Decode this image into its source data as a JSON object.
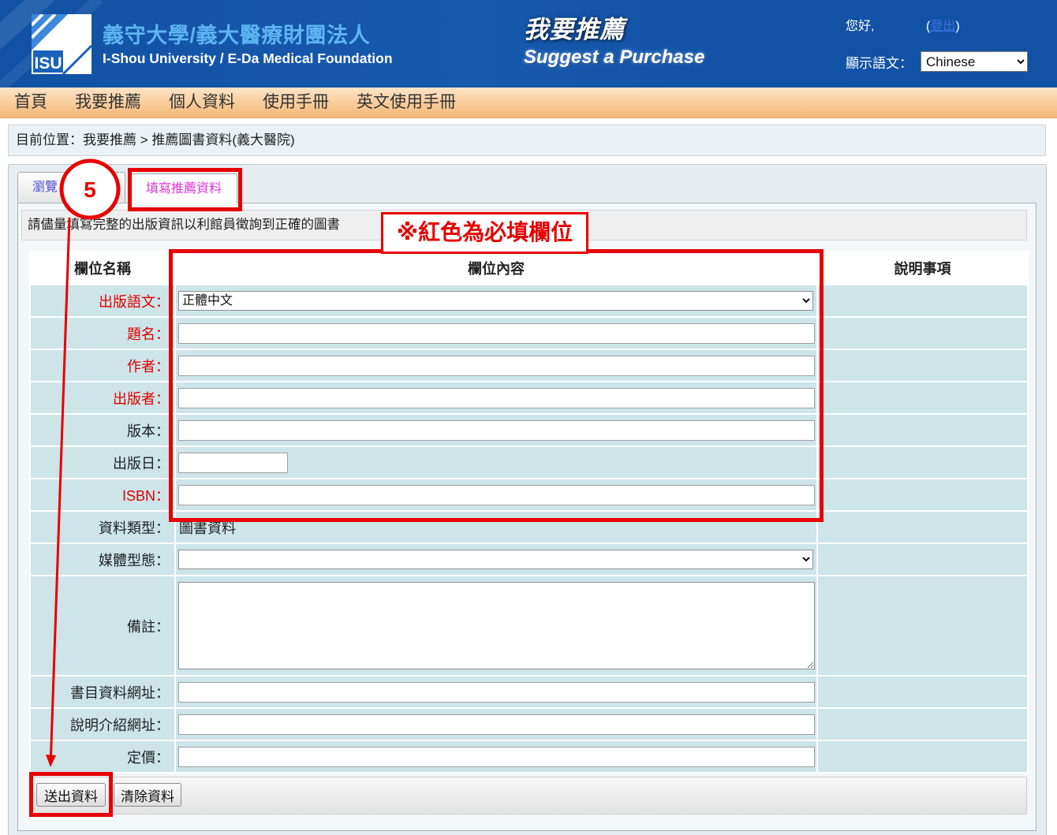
{
  "header": {
    "logo_text": "ISU",
    "org_name_zh": "義守大學/義大醫療財團法人",
    "org_name_en": "I-Shou University / E-Da Medical Foundation",
    "title_zh": "我要推薦",
    "title_en": "Suggest a Purchase",
    "greeting": "您好,",
    "logout": {
      "open": "(",
      "label": "登出",
      "close": ")"
    },
    "language_label": "顯示語文：",
    "language_selected": "Chinese"
  },
  "nav": {
    "items": [
      {
        "label": "首頁"
      },
      {
        "label": "我要推薦"
      },
      {
        "label": "個人資料"
      },
      {
        "label": "使用手冊"
      },
      {
        "label": "英文使用手冊"
      }
    ]
  },
  "breadcrumb": "目前位置：我要推薦 > 推薦圖書資料(義大醫院)",
  "tabs": [
    {
      "label": "瀏覽",
      "active": false
    },
    {
      "label": "填寫推薦資料",
      "active": true
    }
  ],
  "notice": "請儘量填寫完整的出版資訊以利館員徵詢到正確的圖書",
  "form": {
    "headers": {
      "field_name": "欄位名稱",
      "field_content": "欄位內容",
      "notes": "說明事項"
    },
    "rows": [
      {
        "label": "出版語文：",
        "required": true,
        "value": "正體中文"
      },
      {
        "label": "題名：",
        "required": true,
        "value": ""
      },
      {
        "label": "作者：",
        "required": true,
        "value": ""
      },
      {
        "label": "出版者：",
        "required": true,
        "value": ""
      },
      {
        "label": "版本：",
        "required": false,
        "value": ""
      },
      {
        "label": "出版日：",
        "required": false,
        "value": ""
      },
      {
        "label": "ISBN：",
        "required": true,
        "value": ""
      },
      {
        "label": "資料類型：",
        "required": false,
        "value": "圖書資料"
      },
      {
        "label": "媒體型態：",
        "required": false,
        "value": ""
      },
      {
        "label": "備註：",
        "required": false,
        "value": ""
      },
      {
        "label": "書目資料網址：",
        "required": false,
        "value": ""
      },
      {
        "label": "說明介紹網址：",
        "required": false,
        "value": ""
      },
      {
        "label": "定價：",
        "required": false,
        "value": ""
      }
    ]
  },
  "buttons": {
    "submit": "送出資料",
    "clear": "清除資料"
  },
  "annotations": {
    "step": "5",
    "required_note": "※紅色為必填欄位"
  },
  "colors": {
    "header_bg": "#1252a5",
    "org_name": "#5db4f2",
    "nav_bg": "#f8c995",
    "link": "#3b6fe0",
    "inactive_tab": "#4b4fd0",
    "active_tab": "#d936d4",
    "row_bg": "#cde4e9",
    "required_label": "#e00000",
    "annotation": "#e60000"
  }
}
